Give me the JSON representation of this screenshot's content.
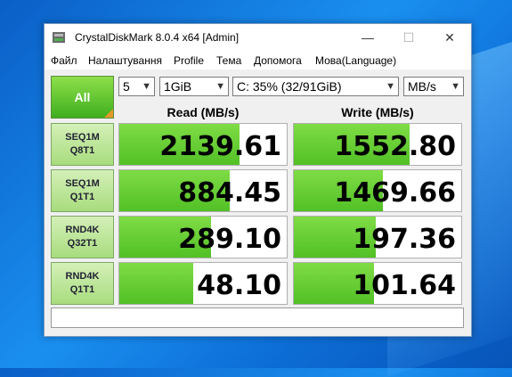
{
  "window": {
    "title": "CrystalDiskMark 8.0.4 x64 [Admin]"
  },
  "window_controls": {
    "minimize": "—",
    "maximize": "☐",
    "close": "✕"
  },
  "menu": [
    "Файл",
    "Налаштування",
    "Profile",
    "Тема",
    "Допомога",
    "Мова(Language)"
  ],
  "controls": {
    "all_label": "All",
    "count": "5",
    "size": "1GiB",
    "drive": "C: 35% (32/91GiB)",
    "unit": "MB/s"
  },
  "headers": {
    "read": "Read (MB/s)",
    "write": "Write (MB/s)"
  },
  "tests": [
    {
      "line1": "SEQ1M",
      "line2": "Q8T1",
      "read": "2139.61",
      "write": "1552.80",
      "read_fill": 0.72,
      "write_fill": 0.69
    },
    {
      "line1": "SEQ1M",
      "line2": "Q1T1",
      "read": "884.45",
      "write": "1469.66",
      "read_fill": 0.66,
      "write_fill": 0.53
    },
    {
      "line1": "RND4K",
      "line2": "Q32T1",
      "read": "289.10",
      "write": "197.36",
      "read_fill": 0.55,
      "write_fill": 0.49
    },
    {
      "line1": "RND4K",
      "line2": "Q1T1",
      "read": "48.10",
      "write": "101.64",
      "read_fill": 0.44,
      "write_fill": 0.48
    }
  ],
  "comment": "",
  "colors": {
    "accent_green": "#52c026",
    "all_button_green": "#3fae1e",
    "desktop_blue": "#1a8ff0"
  }
}
